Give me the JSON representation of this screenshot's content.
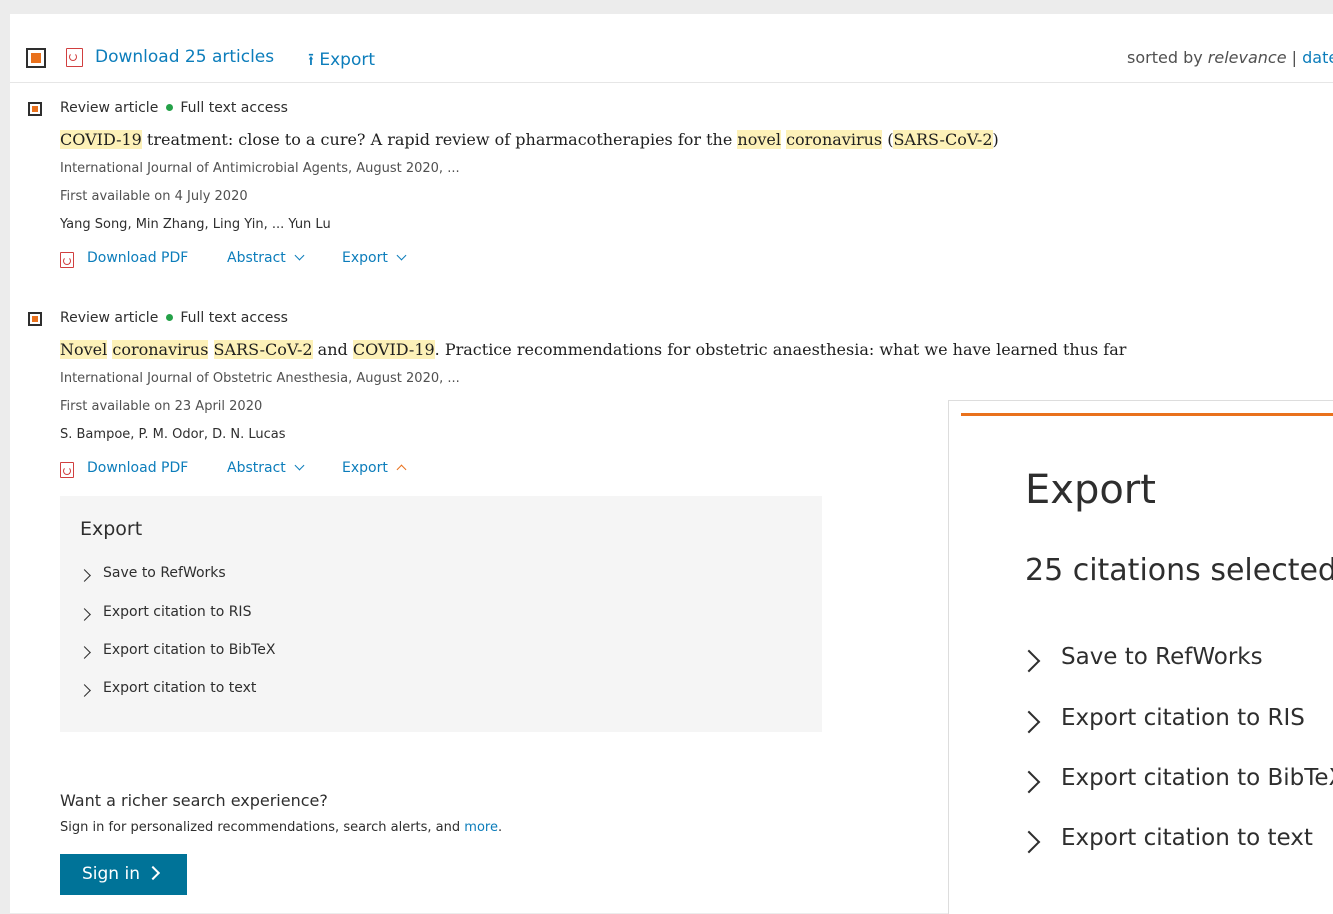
{
  "toolbar": {
    "download_label": "Download 25 articles",
    "export_label": "Export",
    "sorted_by_prefix": "sorted by",
    "sort_relevance": "relevance",
    "sort_separator": "|",
    "sort_date": "date"
  },
  "results": [
    {
      "type": "Review article",
      "access": "Full text access",
      "title_parts": [
        "COVID-19",
        " treatment: close to a cure? A rapid review of pharmacotherapies for the ",
        "novel",
        " ",
        "coronavirus",
        " (",
        "SARS-CoV-2",
        ")"
      ],
      "journal": "International Journal of Antimicrobial Agents, August 2020, ...",
      "first_available": "First available on 4 July 2020",
      "authors": "Yang Song, Min Zhang, Ling Yin, ... Yun Lu",
      "download_pdf": "Download PDF",
      "abstract": "Abstract",
      "export": "Export"
    },
    {
      "type": "Review article",
      "access": "Full text access",
      "title_parts": [
        "Novel",
        " ",
        "coronavirus",
        " ",
        "SARS-CoV-2",
        " and ",
        "COVID-19",
        ". Practice recommendations for obstetric anaesthesia: what we have learned thus far"
      ],
      "journal": "International Journal of Obstetric Anesthesia, August 2020, ...",
      "first_available": "First available on 23 April 2020",
      "authors": "S. Bampoe, P. M. Odor, D. N. Lucas",
      "download_pdf": "Download PDF",
      "abstract": "Abstract",
      "export": "Export"
    }
  ],
  "export_panel": {
    "heading": "Export",
    "options": [
      "Save to RefWorks",
      "Export citation to RIS",
      "Export citation to BibTeX",
      "Export citation to text"
    ]
  },
  "promo": {
    "heading": "Want a richer search experience?",
    "text": "Sign in for personalized recommendations, search alerts, and",
    "more_link": "more",
    "period": ".",
    "signin_label": "Sign in"
  },
  "zoom_panel": {
    "heading": "Export",
    "selected": "25 citations selected",
    "options": [
      "Save to RefWorks",
      "Export citation to RIS",
      "Export citation to BibTeX",
      "Export citation to text"
    ]
  },
  "colors": {
    "accent_orange": "#e9711c",
    "link_blue": "#0c7dbb",
    "signin_blue": "#007398",
    "highlight": "#fdf1b8",
    "access_green": "#24a148"
  }
}
